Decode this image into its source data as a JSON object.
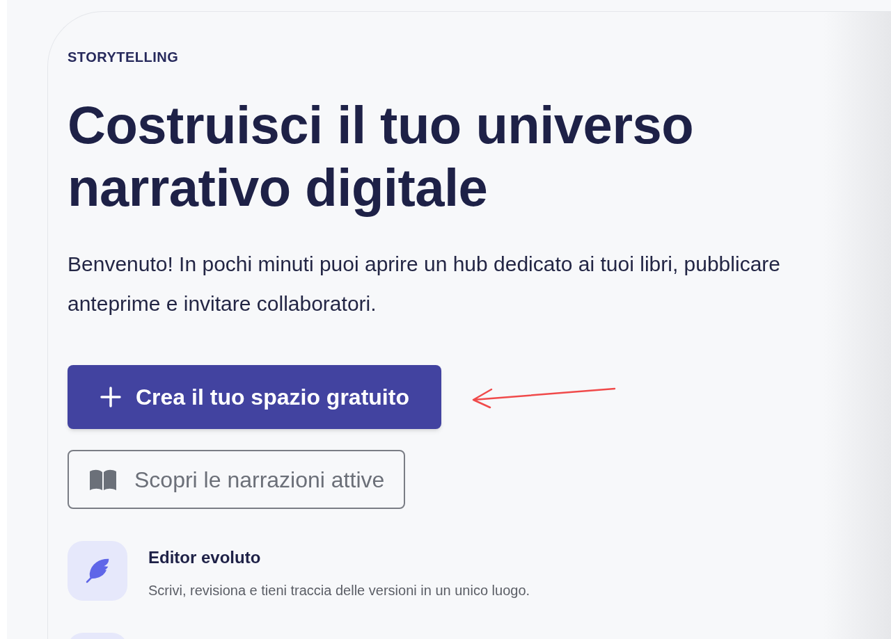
{
  "eyebrow": "STORYTELLING",
  "title": "Costruisci il tuo universo narrativo digitale",
  "description": "Benvenuto! In pochi minuti puoi aprire un hub dedicato ai tuoi libri, pubblicare anteprime e invitare collaboratori.",
  "primary_button": {
    "label": "Crea il tuo spazio gratuito"
  },
  "secondary_button": {
    "label": "Scopri le narrazioni attive"
  },
  "features": [
    {
      "title": "Editor evoluto",
      "description": "Scrivi, revisiona e tieni traccia delle versioni in un unico luogo."
    }
  ]
}
